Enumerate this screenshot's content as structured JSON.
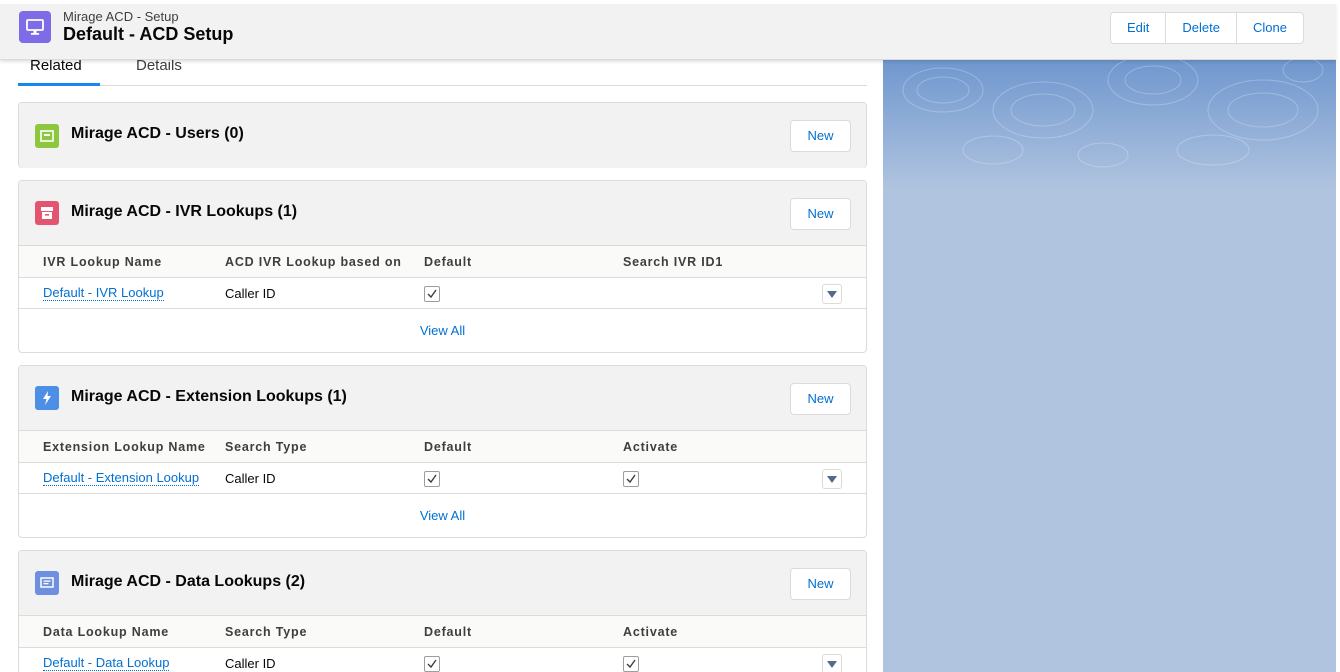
{
  "header": {
    "subtitle": "Mirage ACD - Setup",
    "title": "Default - ACD Setup",
    "icon": "desktop-icon",
    "buttons": {
      "edit": "Edit",
      "delete": "Delete",
      "clone": "Clone"
    }
  },
  "tabs": {
    "related": "Related",
    "details": "Details"
  },
  "cards": {
    "users": {
      "title": "Mirage ACD - Users (0)",
      "new_label": "New",
      "icon": "users-object-icon",
      "icon_color": "#8dc63f"
    },
    "ivr": {
      "title": "Mirage ACD - IVR Lookups (1)",
      "new_label": "New",
      "icon": "archive-object-icon",
      "icon_color": "#e2546f",
      "columns": [
        "IVR Lookup Name",
        "ACD IVR Lookup based on",
        "Default",
        "Search IVR ID1"
      ],
      "row": {
        "name": "Default - IVR Lookup",
        "based_on": "Caller ID",
        "default": true
      },
      "view_all": "View All"
    },
    "extension": {
      "title": "Mirage ACD - Extension Lookups (1)",
      "new_label": "New",
      "icon": "lightning-object-icon",
      "icon_color": "#4e8fe6",
      "columns": [
        "Extension Lookup Name",
        "Search Type",
        "Default",
        "Activate"
      ],
      "row": {
        "name": "Default - Extension Lookup",
        "search_type": "Caller ID",
        "default": true,
        "activate": true
      },
      "view_all": "View All"
    },
    "data": {
      "title": "Mirage ACD - Data Lookups (2)",
      "new_label": "New",
      "icon": "data-object-icon",
      "icon_color": "#6e8fe0",
      "columns": [
        "Data Lookup Name",
        "Search Type",
        "Default",
        "Activate"
      ],
      "row": {
        "name": "Default - Data Lookup",
        "search_type": "Caller ID",
        "default": true,
        "activate": true
      }
    }
  },
  "colors": {
    "accent": "#0070d2",
    "tab_active": "#1589ee",
    "header_icon": "#7e6be7",
    "background": "#b0c4df"
  }
}
